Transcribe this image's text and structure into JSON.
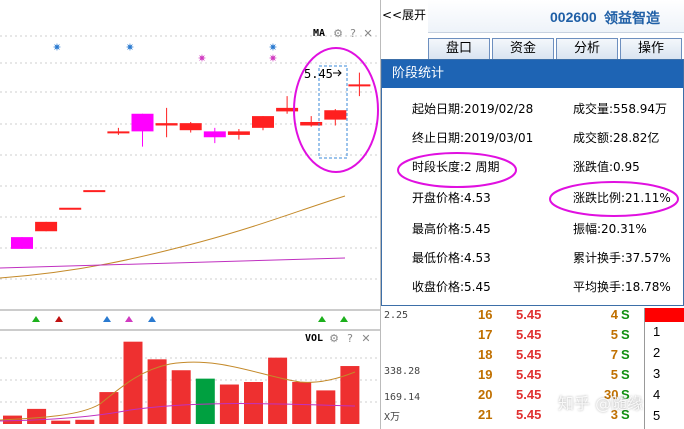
{
  "stock": {
    "code": "002600",
    "name": "领益智造"
  },
  "expand_label": "<<展开",
  "tabs": [
    "盘口",
    "资金",
    "分析",
    "操作"
  ],
  "chart": {
    "ma_label": "MA",
    "vol_label": "VOL",
    "price_marker": "5.45",
    "price_axis_value": "2.25",
    "vol_axis": [
      "338.28",
      "169.14",
      "X万"
    ]
  },
  "popup": {
    "title": "阶段统计",
    "left": [
      {
        "k": "起始日期:",
        "v": "2019/02/28"
      },
      {
        "k": "终止日期:",
        "v": "2019/03/01"
      },
      {
        "k": "时段长度:",
        "v": "2 周期"
      },
      {
        "k": "开盘价格:",
        "v": "4.53"
      },
      {
        "k": "最高价格:",
        "v": "5.45"
      },
      {
        "k": "最低价格:",
        "v": "4.53"
      },
      {
        "k": "收盘价格:",
        "v": "5.45"
      }
    ],
    "right": [
      {
        "k": "成交量:",
        "v": "558.94万"
      },
      {
        "k": "成交额:",
        "v": "28.82亿"
      },
      {
        "k": "涨跌值:",
        "v": "0.95"
      },
      {
        "k": "涨跌比例:",
        "v": "21.11%"
      },
      {
        "k": "振幅:",
        "v": "20.31%"
      },
      {
        "k": "累计换手:",
        "v": "37.57%"
      },
      {
        "k": "平均换手:",
        "v": "18.78%"
      }
    ]
  },
  "quotes": [
    {
      "num": "16",
      "price": "5.45",
      "vol": "4",
      "flag": "S"
    },
    {
      "num": "17",
      "price": "5.45",
      "vol": "5",
      "flag": "S"
    },
    {
      "num": "18",
      "price": "5.45",
      "vol": "7",
      "flag": "S"
    },
    {
      "num": "19",
      "price": "5.45",
      "vol": "5",
      "flag": "S"
    },
    {
      "num": "20",
      "price": "5.45",
      "vol": "30",
      "flag": "S"
    },
    {
      "num": "21",
      "price": "5.45",
      "vol": "3",
      "flag": "S"
    }
  ],
  "side_list": [
    "1",
    "2",
    "3",
    "4",
    "5"
  ],
  "watermark": "知乎 @随缘",
  "colors": {
    "accent": "#1e64b4",
    "up": "#ff3030",
    "down": "#00a040",
    "highlight": "#ff00ff"
  },
  "chart_data": {
    "type": "candlestick",
    "candles": [
      {
        "o": 4.05,
        "c": 3.95,
        "h": 4.05,
        "l": 3.95,
        "up": false
      },
      {
        "o": 4.1,
        "c": 4.18,
        "h": 4.18,
        "l": 4.1,
        "up": true
      },
      {
        "o": 4.3,
        "c": 4.3,
        "h": 4.3,
        "l": 4.3,
        "up": true
      },
      {
        "o": 4.45,
        "c": 4.45,
        "h": 4.45,
        "l": 4.45,
        "up": true
      },
      {
        "o": 4.95,
        "c": 4.95,
        "h": 4.98,
        "l": 4.92,
        "up": true
      },
      {
        "o": 4.95,
        "c": 5.1,
        "h": 5.1,
        "l": 4.82,
        "up": false
      },
      {
        "o": 5.02,
        "c": 5.0,
        "h": 5.15,
        "l": 4.9,
        "up": true
      },
      {
        "o": 5.02,
        "c": 4.96,
        "h": 5.03,
        "l": 4.94,
        "up": true
      },
      {
        "o": 4.95,
        "c": 4.9,
        "h": 4.98,
        "l": 4.85,
        "up": false
      },
      {
        "o": 4.95,
        "c": 4.92,
        "h": 4.97,
        "l": 4.88,
        "up": true
      },
      {
        "o": 4.98,
        "c": 5.08,
        "h": 5.08,
        "l": 4.96,
        "up": true
      },
      {
        "o": 5.12,
        "c": 5.15,
        "h": 5.25,
        "l": 5.1,
        "up": true
      },
      {
        "o": 5.03,
        "c": 5.0,
        "h": 5.08,
        "l": 4.99,
        "up": true
      },
      {
        "o": 5.05,
        "c": 5.13,
        "h": 5.14,
        "l": 5.0,
        "up": true
      },
      {
        "o": 5.35,
        "c": 5.35,
        "h": 5.45,
        "l": 5.25,
        "up": true
      }
    ],
    "volume": [
      10,
      18,
      4,
      5,
      38,
      98,
      77,
      64,
      54,
      47,
      50,
      79,
      50,
      40,
      69
    ]
  }
}
